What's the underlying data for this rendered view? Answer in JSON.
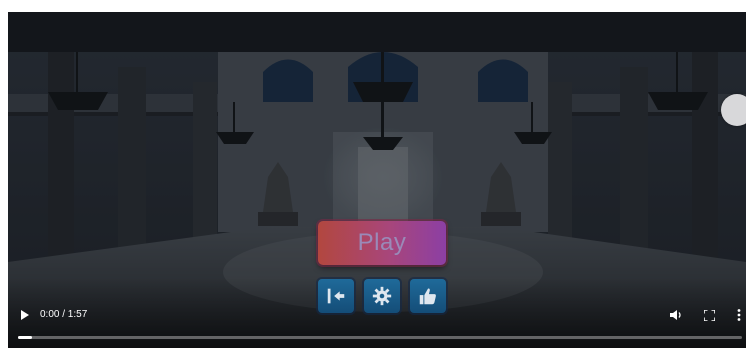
{
  "menu": {
    "play_label": "Play",
    "buttons": [
      {
        "icon": "exit-icon"
      },
      {
        "icon": "gear-icon"
      },
      {
        "icon": "thumbs-up-icon"
      }
    ]
  },
  "player": {
    "play_icon": "play-icon",
    "time_display": "0:00 / 1:57",
    "progress_fraction": 0.02,
    "volume_icon": "volume-icon",
    "fullscreen_icon": "fullscreen-icon",
    "more_icon": "more-vertical-icon"
  },
  "colors": {
    "play_gradient_start": "#b2473f",
    "play_gradient_end": "#8c3fa4",
    "play_text": "#9a8ab8",
    "icon_button_blue": "#1f6a9a"
  }
}
